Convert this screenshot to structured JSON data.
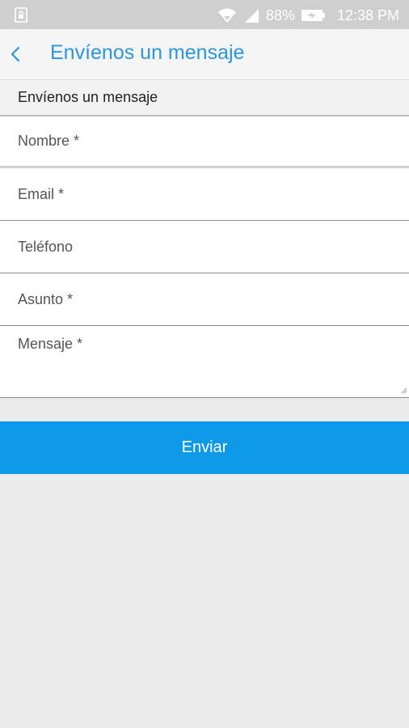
{
  "status_bar": {
    "battery": "88%",
    "time": "12:38 PM",
    "icons": [
      "sim-lock-icon",
      "wifi-icon",
      "signal-icon",
      "battery-icon"
    ]
  },
  "app_bar": {
    "title": "Envíenos un mensaje",
    "back_icon": "chevron-left-icon",
    "accent_color": "#2a95e0"
  },
  "form": {
    "section_title": "Envíenos un mensaje",
    "fields": {
      "nombre": {
        "placeholder": "Nombre *",
        "value": ""
      },
      "email": {
        "placeholder": "Email *",
        "value": ""
      },
      "telefono": {
        "placeholder": "Teléfono",
        "value": ""
      },
      "asunto": {
        "placeholder": "Asunto *",
        "value": ""
      },
      "mensaje": {
        "placeholder": "Mensaje *",
        "value": ""
      }
    },
    "submit_label": "Enviar",
    "submit_color": "#0e99e8"
  }
}
